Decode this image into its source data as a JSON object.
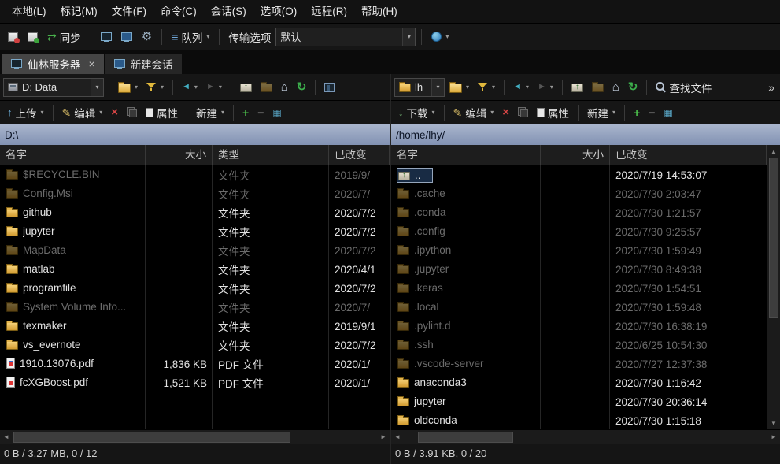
{
  "menubar": {
    "items": [
      {
        "label": "本地(L)"
      },
      {
        "label": "标记(M)"
      },
      {
        "label": "文件(F)"
      },
      {
        "label": "命令(C)"
      },
      {
        "label": "会话(S)"
      },
      {
        "label": "选项(O)"
      },
      {
        "label": "远程(R)"
      },
      {
        "label": "帮助(H)"
      }
    ]
  },
  "toolbar": {
    "sync_label": "同步",
    "queue_label": "队列",
    "transfer_options_label": "传输选项",
    "transfer_preset_value": "默认"
  },
  "tabs": [
    {
      "label": "仙林服务器",
      "close": "×"
    },
    {
      "label": "新建会话"
    }
  ],
  "icons": {
    "dropdown": "▾",
    "back": "◄",
    "forward": "►",
    "home": "⌂",
    "refresh": "↻",
    "gear": "⚙",
    "sync": "⇄",
    "queue": "≡",
    "delete": "×",
    "edit": "✎",
    "upload": "↑",
    "download": "↓",
    "plus": "+",
    "minus": "−",
    "grid": "▦",
    "overflow": "»",
    "scroll_up": "▲",
    "scroll_down": "▼",
    "scroll_left": "◄",
    "scroll_right": "►"
  },
  "left_panel": {
    "drive_value": "D: Data",
    "path": "D:\\",
    "actions": {
      "upload": "上传",
      "edit": "编辑",
      "properties": "属性",
      "new": "新建"
    },
    "columns": {
      "name": "名字",
      "size": "大小",
      "type": "类型",
      "modified": "已改变"
    },
    "files": [
      {
        "name": "$RECYCLE.BIN",
        "size": "",
        "type": "文件夹",
        "modified": "2019/9/",
        "icon": "folder",
        "dimmed": true
      },
      {
        "name": "Config.Msi",
        "size": "",
        "type": "文件夹",
        "modified": "2020/7/",
        "icon": "folder",
        "dimmed": true
      },
      {
        "name": "github",
        "size": "",
        "type": "文件夹",
        "modified": "2020/7/2",
        "icon": "folder"
      },
      {
        "name": "jupyter",
        "size": "",
        "type": "文件夹",
        "modified": "2020/7/2",
        "icon": "folder"
      },
      {
        "name": "MapData",
        "size": "",
        "type": "文件夹",
        "modified": "2020/7/2",
        "icon": "folder",
        "dimmed": true
      },
      {
        "name": "matlab",
        "size": "",
        "type": "文件夹",
        "modified": "2020/4/1",
        "icon": "folder"
      },
      {
        "name": "programfile",
        "size": "",
        "type": "文件夹",
        "modified": "2020/7/2",
        "icon": "folder"
      },
      {
        "name": "System Volume Info...",
        "size": "",
        "type": "文件夹",
        "modified": "2020/7/",
        "icon": "folder",
        "dimmed": true
      },
      {
        "name": "texmaker",
        "size": "",
        "type": "文件夹",
        "modified": "2019/9/1",
        "icon": "folder"
      },
      {
        "name": "vs_evernote",
        "size": "",
        "type": "文件夹",
        "modified": "2020/7/2",
        "icon": "folder"
      },
      {
        "name": "1910.13076.pdf",
        "size": "1,836 KB",
        "type": "PDF 文件",
        "modified": "2020/1/",
        "icon": "pdf"
      },
      {
        "name": "fcXGBoost.pdf",
        "size": "1,521 KB",
        "type": "PDF 文件",
        "modified": "2020/1/",
        "icon": "pdf"
      }
    ],
    "status": "0 B / 3.27 MB,  0 / 12"
  },
  "right_panel": {
    "drive_value": "lh",
    "path": "/home/lhy/",
    "find_label": "查找文件",
    "actions": {
      "download": "下载",
      "edit": "编辑",
      "properties": "属性",
      "new": "新建"
    },
    "columns": {
      "name": "名字",
      "size": "大小",
      "modified": "已改变"
    },
    "files": [
      {
        "name": "..",
        "size": "",
        "modified": "2020/7/19 14:53:07",
        "icon": "updir",
        "selected": true
      },
      {
        "name": ".cache",
        "size": "",
        "modified": "2020/7/30 2:03:47",
        "icon": "folder",
        "dimmed": true
      },
      {
        "name": ".conda",
        "size": "",
        "modified": "2020/7/30 1:21:57",
        "icon": "folder",
        "dimmed": true
      },
      {
        "name": ".config",
        "size": "",
        "modified": "2020/7/30 9:25:57",
        "icon": "folder",
        "dimmed": true
      },
      {
        "name": ".ipython",
        "size": "",
        "modified": "2020/7/30 1:59:49",
        "icon": "folder",
        "dimmed": true
      },
      {
        "name": ".jupyter",
        "size": "",
        "modified": "2020/7/30 8:49:38",
        "icon": "folder",
        "dimmed": true
      },
      {
        "name": ".keras",
        "size": "",
        "modified": "2020/7/30 1:54:51",
        "icon": "folder",
        "dimmed": true
      },
      {
        "name": ".local",
        "size": "",
        "modified": "2020/7/30 1:59:48",
        "icon": "folder",
        "dimmed": true
      },
      {
        "name": ".pylint.d",
        "size": "",
        "modified": "2020/7/30 16:38:19",
        "icon": "folder",
        "dimmed": true
      },
      {
        "name": ".ssh",
        "size": "",
        "modified": "2020/6/25 10:54:30",
        "icon": "folder",
        "dimmed": true
      },
      {
        "name": ".vscode-server",
        "size": "",
        "modified": "2020/7/27 12:37:38",
        "icon": "folder",
        "dimmed": true
      },
      {
        "name": "anaconda3",
        "size": "",
        "modified": "2020/7/30 1:16:42",
        "icon": "folder"
      },
      {
        "name": "jupyter",
        "size": "",
        "modified": "2020/7/30 20:36:14",
        "icon": "folder"
      },
      {
        "name": "oldconda",
        "size": "",
        "modified": "2020/7/30 1:15:18",
        "icon": "folder"
      }
    ],
    "status": "0 B / 3.91 KB,  0 / 20"
  }
}
